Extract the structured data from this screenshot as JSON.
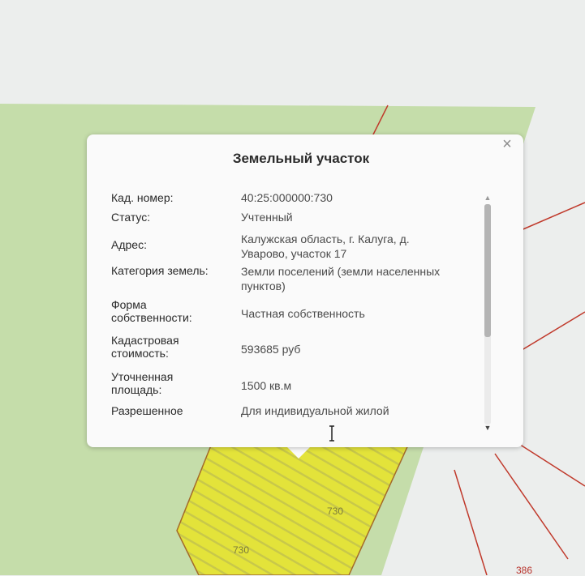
{
  "popup": {
    "title": "Земельный участок",
    "close_icon": "close-icon",
    "rows": [
      {
        "label": "Кад. номер:",
        "value": "40:25:000000:730"
      },
      {
        "label": "Статус:",
        "value": "Учтенный"
      },
      {
        "label": "Адрес:",
        "value": "Калужская область, г. Калуга, д. Уварово, участок 17"
      },
      {
        "label": "Категория земель:",
        "value": "Земли поселений (земли населенных пунктов)"
      },
      {
        "label": "Форма собственности:",
        "value": "Частная собственность"
      },
      {
        "label": "Кадастровая стоимость:",
        "value": "593685 руб"
      },
      {
        "label": "Уточненная площадь:",
        "value": "1500 кв.м"
      },
      {
        "label": "Разрешенное",
        "value": "Для индивидуальной жилой"
      }
    ]
  },
  "map": {
    "parcel_labels": [
      "730",
      "730",
      "386"
    ],
    "colors": {
      "green_area": "#c5ddaa",
      "parcel_fill": "#e3e33a",
      "parcel_hatch": "#c8c84a",
      "parcel_border": "#c0392b",
      "background": "#eceeed"
    }
  }
}
